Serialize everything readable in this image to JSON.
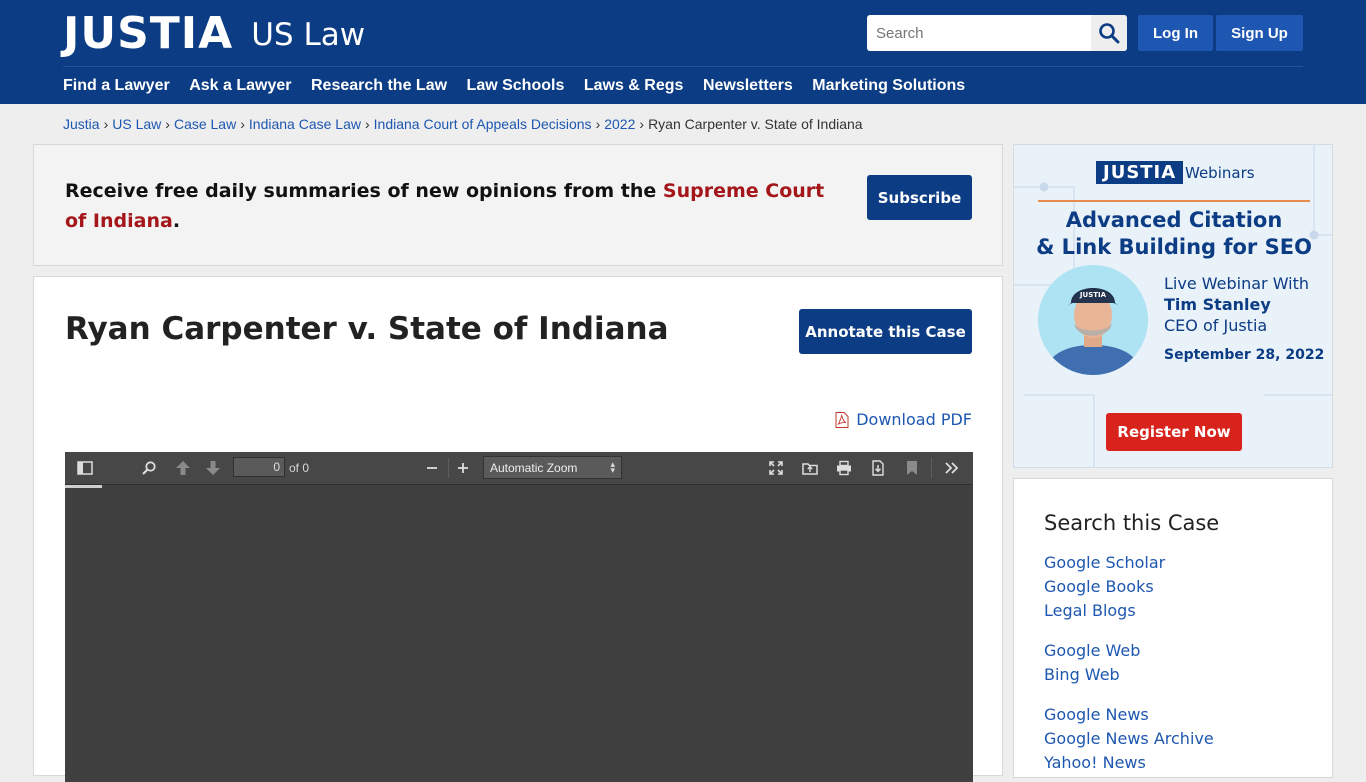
{
  "header": {
    "logo_word": "JUSTIA",
    "logo_sub": "US Law",
    "search_placeholder": "Search",
    "login_label": "Log In",
    "signup_label": "Sign Up",
    "nav": [
      "Find a Lawyer",
      "Ask a Lawyer",
      "Research the Law",
      "Law Schools",
      "Laws & Regs",
      "Newsletters",
      "Marketing Solutions"
    ]
  },
  "breadcrumb": {
    "items": [
      "Justia",
      "US Law",
      "Case Law",
      "Indiana Case Law",
      "Indiana Court of Appeals Decisions",
      "2022"
    ],
    "current": "Ryan Carpenter v. State of Indiana",
    "separator": "›"
  },
  "subscribe": {
    "text_before": "Receive free daily summaries of new opinions from the ",
    "court_link": "Supreme Court of Indiana",
    "text_after": ".",
    "button_label": "Subscribe"
  },
  "case": {
    "title": "Ryan Carpenter v. State of Indiana",
    "annotate_label": "Annotate this Case",
    "download_label": "Download PDF"
  },
  "pdf_viewer": {
    "page_value": "0",
    "page_of": "of 0",
    "zoom": "Automatic Zoom",
    "icons": [
      "sidebar-toggle-icon",
      "find-icon",
      "previous-page-icon",
      "next-page-icon",
      "zoom-out-icon",
      "zoom-in-icon",
      "presentation-mode-icon",
      "open-file-icon",
      "print-icon",
      "download-icon",
      "bookmark-icon",
      "tools-icon"
    ]
  },
  "ad": {
    "logo": "JUSTIA",
    "webinars": "Webinars",
    "title_line1": "Advanced Citation",
    "title_line2": "& Link Building for SEO",
    "cap_text": "JUSTIA",
    "live_line": "Live Webinar With",
    "speaker": "Tim Stanley",
    "role": "CEO of Justia",
    "date": "September 28, 2022",
    "button_label": "Register Now"
  },
  "search_case": {
    "title": "Search this Case",
    "links": [
      "Google Scholar",
      "Google Books",
      "Legal Blogs",
      "Google Web",
      "Bing Web",
      "Google News",
      "Google News Archive",
      "Yahoo! News"
    ]
  },
  "colors": {
    "header_bg": "#0b3c84",
    "accent_blue": "#1e57b1",
    "court_red": "#a4161a",
    "register_red": "#d8231c",
    "viewer_bg": "#404040"
  }
}
